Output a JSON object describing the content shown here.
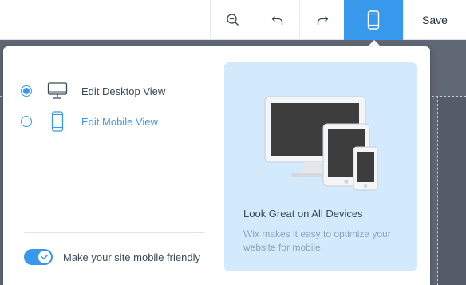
{
  "toolbar": {
    "zoom_icon": "zoom-out-icon",
    "undo_icon": "undo-icon",
    "redo_icon": "redo-icon",
    "mobile_icon": "mobile-phone-icon",
    "save_label": "Save",
    "accent_color": "#3899ec"
  },
  "view_options": [
    {
      "label": "Edit Desktop View",
      "icon": "desktop-monitor-icon",
      "selected": true
    },
    {
      "label": "Edit Mobile View",
      "icon": "mobile-phone-icon",
      "selected": false
    }
  ],
  "mobile_friendly_toggle": {
    "label": "Make your site mobile friendly",
    "enabled": true
  },
  "info_card": {
    "illustration": "devices-illustration",
    "title": "Look Great on All Devices",
    "description": "Wix makes it easy to optimize your website for mobile."
  }
}
